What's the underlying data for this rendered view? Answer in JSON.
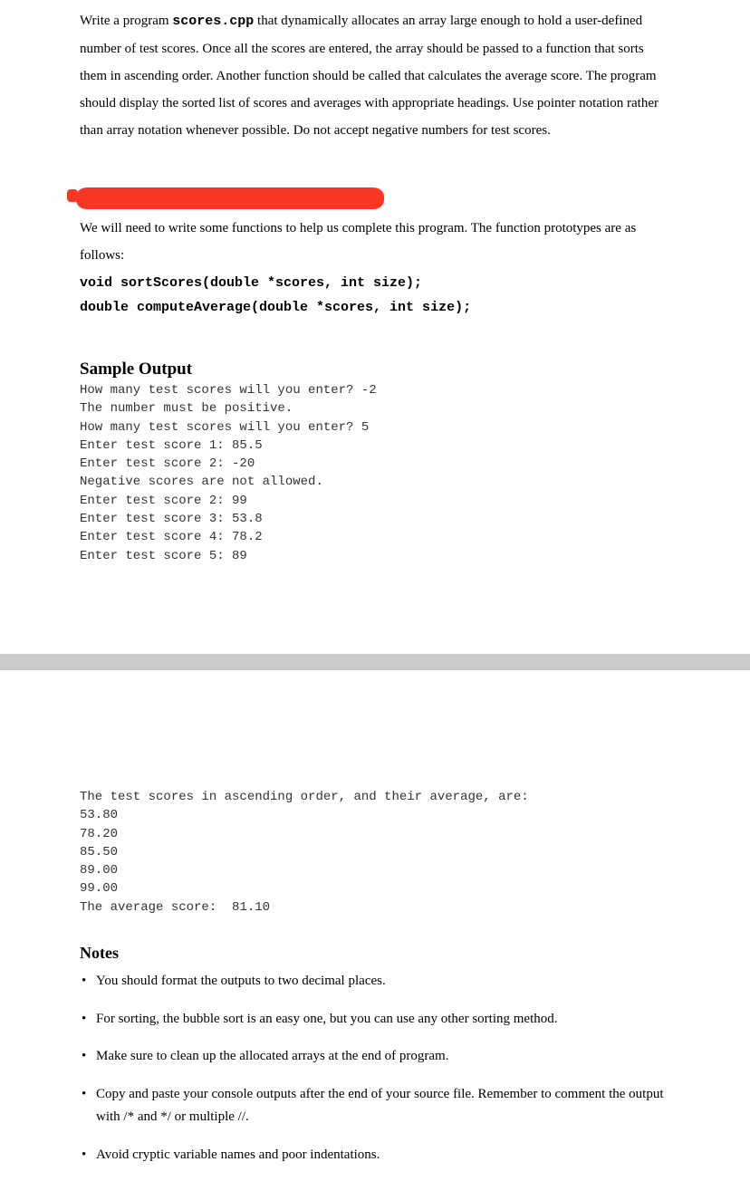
{
  "intro": {
    "prefix": "Write a program ",
    "code": "scores.cpp",
    "suffix": " that dynamically allocates an array large enough to hold a user-defined number of test scores. Once all the scores are entered, the array should be passed to a function that sorts them in ascending order.  Another function should be called that calculates the average score. The program should display the sorted list of scores and averages with appropriate headings.  Use pointer notation rather than array notation whenever possible.  Do not accept negative numbers for test scores."
  },
  "followup": "We will need to write some functions to help us complete this program.  The function prototypes are as follows:",
  "prototypes": {
    "line1": "void sortScores(double *scores, int size);",
    "line2": "double computeAverage(double *scores, int size);"
  },
  "sample_heading": "Sample Output",
  "sample_output_top": "How many test scores will you enter? -2\nThe number must be positive.\nHow many test scores will you enter? 5\nEnter test score 1: 85.5\nEnter test score 2: -20\nNegative scores are not allowed.\nEnter test score 2: 99\nEnter test score 3: 53.8\nEnter test score 4: 78.2\nEnter test score 5: 89",
  "sample_output_bottom": "The test scores in ascending order, and their average, are:\n53.80\n78.20\n85.50\n89.00\n99.00\nThe average score:  81.10",
  "notes_heading": "Notes",
  "notes": {
    "n1": "You should format the outputs to two decimal places.",
    "n2": "For sorting, the bubble sort is an easy one, but you can use any other sorting method.",
    "n3": "Make sure to clean up the allocated arrays at the end of program.",
    "n4": "Copy and paste your console outputs after the end of your source file.  Remember to comment the output with /* and */ or multiple //.",
    "n5": "Avoid cryptic variable names and poor indentations."
  }
}
